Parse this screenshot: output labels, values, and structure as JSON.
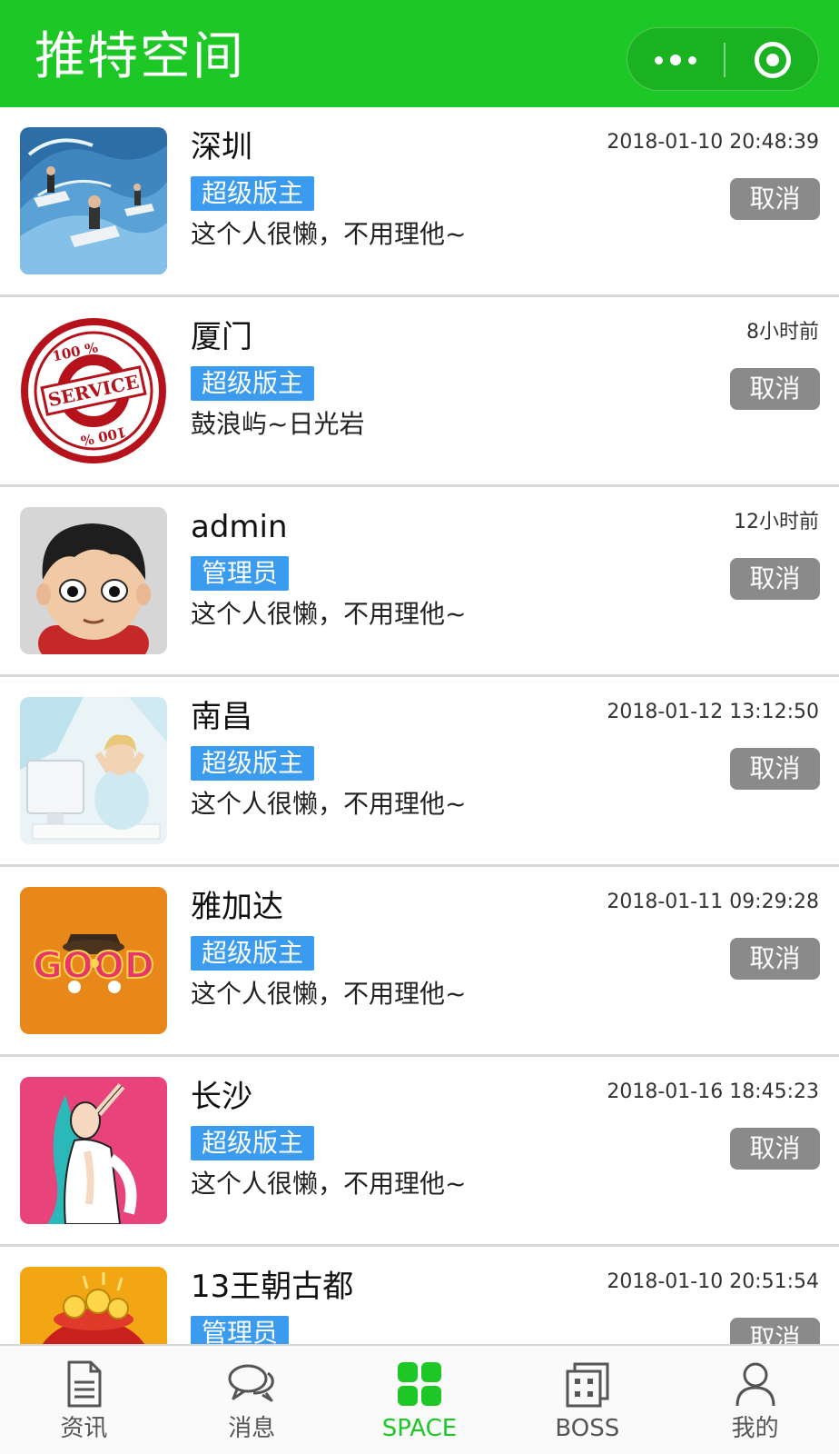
{
  "header": {
    "title": "推特空间",
    "bg_color": "#1dc725",
    "more_icon": "more-dots-icon",
    "close_icon": "target-circle-icon"
  },
  "list": {
    "items": [
      {
        "name": "深圳",
        "time": "2018-01-10 20:48:39",
        "role": "超级版主",
        "desc": "这个人很懒，不用理他~",
        "action": "取消",
        "avatar": "surf-waves-avatar"
      },
      {
        "name": "厦门",
        "time": "8小时前",
        "role": "超级版主",
        "desc": "鼓浪屿~日光岩",
        "action": "取消",
        "avatar": "service-stamp-avatar",
        "avatar_text": {
          "top": "100 %",
          "middle": "SERVICE",
          "bottom": "100 %"
        }
      },
      {
        "name": "admin",
        "time": "12小时前",
        "role": "管理员",
        "desc": "这个人很懒，不用理他~",
        "action": "取消",
        "avatar": "cartoon-boy-avatar"
      },
      {
        "name": "南昌",
        "time": "2018-01-12 13:12:50",
        "role": "超级版主",
        "desc": "这个人很懒，不用理他~",
        "action": "取消",
        "avatar": "woman-computer-avatar"
      },
      {
        "name": "雅加达",
        "time": "2018-01-11 09:29:28",
        "role": "超级版主",
        "desc": "这个人很懒，不用理他~",
        "action": "取消",
        "avatar": "good-logo-avatar",
        "avatar_text": {
          "logo": "GOOD"
        }
      },
      {
        "name": "长沙",
        "time": "2018-01-16 18:45:23",
        "role": "超级版主",
        "desc": "这个人很懒，不用理他~",
        "action": "取消",
        "avatar": "pinup-girl-avatar"
      },
      {
        "name": "13王朝古都",
        "time": "2018-01-10 20:51:54",
        "role": "管理员",
        "desc": "",
        "action": "取消",
        "avatar": "money-bag-avatar"
      }
    ],
    "badge_color": "#3a9bef",
    "cancel_color": "#8a8a8a"
  },
  "tabbar": {
    "tabs": [
      {
        "label": "资讯",
        "icon": "document-icon",
        "active": false
      },
      {
        "label": "消息",
        "icon": "chat-bubbles-icon",
        "active": false
      },
      {
        "label": "SPACE",
        "icon": "grid-squares-icon",
        "active": true
      },
      {
        "label": "BOSS",
        "icon": "building-icon",
        "active": false
      },
      {
        "label": "我的",
        "icon": "person-icon",
        "active": false
      }
    ],
    "active_color": "#1dc725"
  }
}
